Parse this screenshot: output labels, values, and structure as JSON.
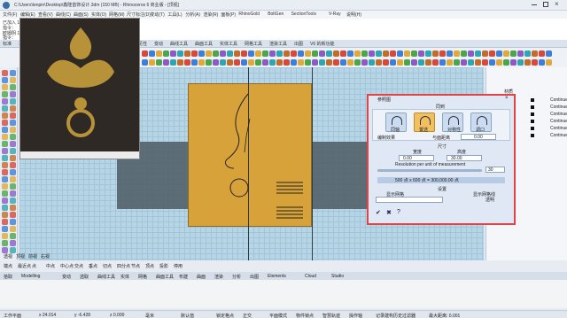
{
  "title_bar": {
    "title": "C:\\Users\\lenpin\\Desktop\\鑫隆首饰设计.3dm (150 MB) - Rhinoceros 6 商业版 - [顶视]"
  },
  "menu": {
    "items": [
      "文件(F)",
      "编辑(E)",
      "查看(V)",
      "曲线(C)",
      "曲面(S)",
      "实体(O)",
      "网格(M)",
      "尺寸标注(D)",
      "变动(T)",
      "工具(L)",
      "分析(A)",
      "渲染(R)",
      "面板(P)",
      "RhinoGold",
      "BoltGen",
      "SectionTools",
      "V-Ray",
      "说明(H)"
    ]
  },
  "command": {
    "lines": [
      "已加入 1 个平面到选取集合。",
      "指令：",
      "欧姆阴 1 个平面到选取集合。",
      "指令："
    ]
  },
  "toolbar_tabs": [
    "标准",
    "工作平面",
    "设置视图",
    "显示",
    "选取",
    "工作视窗配置",
    "可见性",
    "变动",
    "曲线工具",
    "曲面工具",
    "实体工具",
    "网格工具",
    "渲染工具",
    "出图",
    "V6 的新功能"
  ],
  "viewport": {
    "label": "顶视"
  },
  "right_panel": {
    "header_cols": [
      "材质"
    ],
    "layers": [
      "Continue",
      "Continue",
      "Continue",
      "Continue",
      "Continue",
      "Continue"
    ]
  },
  "bottom_tabs": [
    "透视",
    "顶视",
    "前视",
    "右视"
  ],
  "snap_options": [
    "端点",
    "最近点",
    "点",
    "中点",
    "中心点",
    "交点",
    "垂点",
    "切点",
    "四分点",
    "节点",
    "顶点",
    "投影",
    "停用"
  ],
  "status_tabs": [
    "拾取",
    "Modelling",
    "变动",
    "选取",
    "曲线工具",
    "实体",
    "网格",
    "曲面工具",
    "布建",
    "曲面",
    "渲染",
    "分析",
    "出图",
    "Elements",
    "Cloud",
    "Studio"
  ],
  "status_bar": {
    "plane": "工作平面",
    "x": "x 24.014",
    "y": "y -6.428",
    "z": "z 0.000",
    "unit": "毫米",
    "layer": "默认值",
    "items": [
      "锁定格点",
      "正交",
      "平面模式",
      "物件锁点",
      "智慧轨迹",
      "操作轴",
      "记录建构历史",
      "过滤器",
      "最大距离: 0.001"
    ]
  },
  "dialog": {
    "title": "参照图",
    "section_position": "同到",
    "options": [
      "同轴",
      "置选",
      "对称性",
      "调口"
    ],
    "auto_label": "编制效果",
    "auto_value": "与面距离",
    "auto_num": "0.00",
    "section_size": "尺寸",
    "width_label": "宽度",
    "height_label": "高度",
    "width_value": "0.00",
    "height_value": "30.00",
    "resolution_text": "Resolution per unit of measurement",
    "res_value": "30",
    "scale_text": "500 点 x 600 点 = 300,000.00 点",
    "section_settings": "设置",
    "show_grid_label": "显示网格",
    "show_grid_check": "显示网格线",
    "transparency_label": "透明"
  },
  "colors": {
    "accent": "#e04444",
    "panel_bg": "#dfe8f4",
    "viewport": "#b6d5e6",
    "gold": "#d8a23a"
  }
}
